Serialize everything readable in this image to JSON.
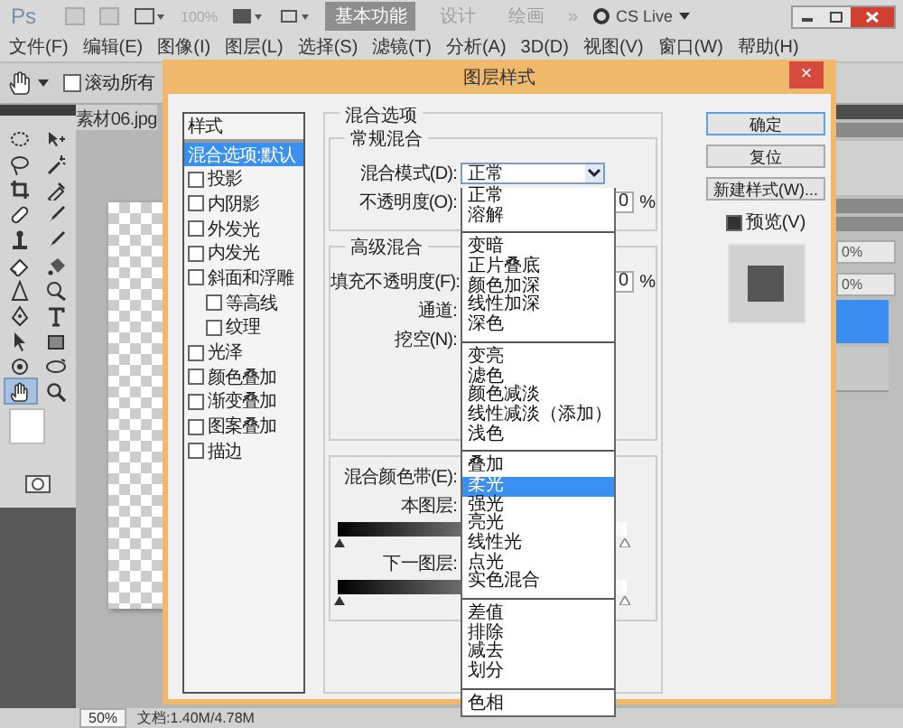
{
  "app": {
    "logo": "Ps",
    "zoom": "100%",
    "workspaces": [
      {
        "label": "基本功能",
        "selected": true
      },
      {
        "label": "设计",
        "selected": false
      },
      {
        "label": "绘画",
        "selected": false
      }
    ],
    "more": "»",
    "cs_live": "CS Live"
  },
  "menu": [
    "文件(F)",
    "编辑(E)",
    "图像(I)",
    "图层(L)",
    "选择(S)",
    "滤镜(T)",
    "分析(A)",
    "3D(D)",
    "视图(V)",
    "窗口(W)",
    "帮助(H)"
  ],
  "options_bar": {
    "scroll_all": {
      "label": "滚动所有",
      "checked": false
    }
  },
  "tools": [
    {
      "kind": "ellipse",
      "selected": false
    },
    {
      "kind": "move",
      "selected": false
    },
    {
      "kind": "lasso",
      "selected": false
    },
    {
      "kind": "wand",
      "selected": false
    },
    {
      "kind": "crop",
      "selected": false
    },
    {
      "kind": "dropper",
      "selected": false
    },
    {
      "kind": "bandage",
      "selected": false
    },
    {
      "kind": "brush",
      "selected": false
    },
    {
      "kind": "stamp",
      "selected": false
    },
    {
      "kind": "brush",
      "selected": false
    },
    {
      "kind": "eraser",
      "selected": false
    },
    {
      "kind": "bucket",
      "selected": false
    },
    {
      "kind": "triangle",
      "selected": false
    },
    {
      "kind": "dodge",
      "selected": false
    },
    {
      "kind": "pen",
      "selected": false
    },
    {
      "kind": "type",
      "selected": false
    },
    {
      "kind": "cursor",
      "selected": false
    },
    {
      "kind": "rect",
      "selected": false
    },
    {
      "kind": "rotate",
      "selected": false
    },
    {
      "kind": "orbit",
      "selected": false
    },
    {
      "kind": "hand",
      "selected": true
    },
    {
      "kind": "zoom",
      "selected": false
    }
  ],
  "document": {
    "tab": "素材06.jpg",
    "zoom": "50%",
    "doc_size": "文档:1.40M/4.78M"
  },
  "layers_panel": {
    "opacity": "0%",
    "fill": "0%"
  },
  "dialog": {
    "title": "图层样式",
    "close": "×",
    "styles_header": "样式",
    "styles": [
      {
        "label": "混合选项:默认",
        "kind": "option",
        "selected": true
      },
      {
        "label": "投影",
        "kind": "effect",
        "checked": false,
        "selected": false
      },
      {
        "label": "内阴影",
        "kind": "effect",
        "checked": false,
        "selected": false
      },
      {
        "label": "外发光",
        "kind": "effect",
        "checked": false,
        "selected": false
      },
      {
        "label": "内发光",
        "kind": "effect",
        "checked": false,
        "selected": false
      },
      {
        "label": "斜面和浮雕",
        "kind": "effect",
        "checked": false,
        "selected": false,
        "children": [
          {
            "label": "等高线",
            "kind": "effect",
            "checked": false,
            "selected": false
          },
          {
            "label": "纹理",
            "kind": "effect",
            "checked": false,
            "selected": false
          }
        ]
      },
      {
        "label": "光泽",
        "kind": "effect",
        "checked": false,
        "selected": false
      },
      {
        "label": "颜色叠加",
        "kind": "effect",
        "checked": false,
        "selected": false
      },
      {
        "label": "渐变叠加",
        "kind": "effect",
        "checked": false,
        "selected": false
      },
      {
        "label": "图案叠加",
        "kind": "effect",
        "checked": false,
        "selected": false
      },
      {
        "label": "描边",
        "kind": "effect",
        "checked": false,
        "selected": false
      }
    ],
    "blending": {
      "title": "混合选项",
      "general": {
        "title": "常规混合",
        "mode_label": "混合模式(D):",
        "mode_value": "正常",
        "opacity_label": "不透明度(O):",
        "opacity_value": "0",
        "opacity_unit": "%"
      },
      "advanced": {
        "title": "高级混合",
        "fill_label": "填充不透明度(F):",
        "fill_value": "0",
        "fill_unit": "%",
        "channels_label": "通道:",
        "knockout_label": "挖空(N):"
      },
      "blend_if": {
        "label": "混合颜色带(E):",
        "this_layer": "本图层:",
        "underlying": "下一图层:"
      }
    },
    "mode_menu": [
      [
        {
          "label": "正常",
          "selected": false
        },
        {
          "label": "溶解",
          "selected": false
        }
      ],
      [
        {
          "label": "变暗",
          "selected": false
        },
        {
          "label": "正片叠底",
          "selected": false
        },
        {
          "label": "颜色加深",
          "selected": false
        },
        {
          "label": "线性加深",
          "selected": false
        },
        {
          "label": "深色",
          "selected": false
        }
      ],
      [
        {
          "label": "变亮",
          "selected": false
        },
        {
          "label": "滤色",
          "selected": false
        },
        {
          "label": "颜色减淡",
          "selected": false
        },
        {
          "label": "线性减淡（添加）",
          "selected": false
        },
        {
          "label": "浅色",
          "selected": false
        }
      ],
      [
        {
          "label": "叠加",
          "selected": false
        },
        {
          "label": "柔光",
          "selected": true
        },
        {
          "label": "强光",
          "selected": false
        },
        {
          "label": "亮光",
          "selected": false
        },
        {
          "label": "线性光",
          "selected": false
        },
        {
          "label": "点光",
          "selected": false
        },
        {
          "label": "实色混合",
          "selected": false
        }
      ],
      [
        {
          "label": "差值",
          "selected": false
        },
        {
          "label": "排除",
          "selected": false
        },
        {
          "label": "减去",
          "selected": false
        },
        {
          "label": "划分",
          "selected": false
        }
      ],
      [
        {
          "label": "色相",
          "selected": false
        }
      ]
    ],
    "buttons": [
      {
        "label": "确定",
        "default": true
      },
      {
        "label": "复位",
        "default": false
      },
      {
        "label": "新建样式(W)...",
        "default": false
      }
    ],
    "preview": {
      "label": "预览(V)",
      "checked": true
    }
  }
}
